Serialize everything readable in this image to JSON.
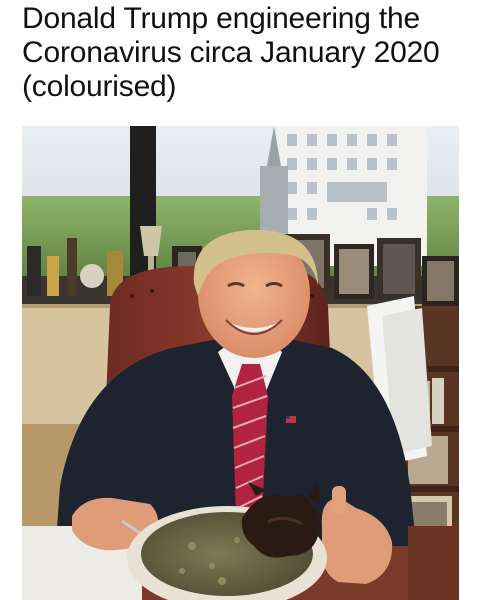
{
  "caption": {
    "text": "Donald Trump engineering the Coronavirus circa January 2020 (colourised)"
  },
  "photo": {
    "tie_color": "#b0243f",
    "suit_color": "#1d2430",
    "bowl_color": "#e9e2d4"
  }
}
